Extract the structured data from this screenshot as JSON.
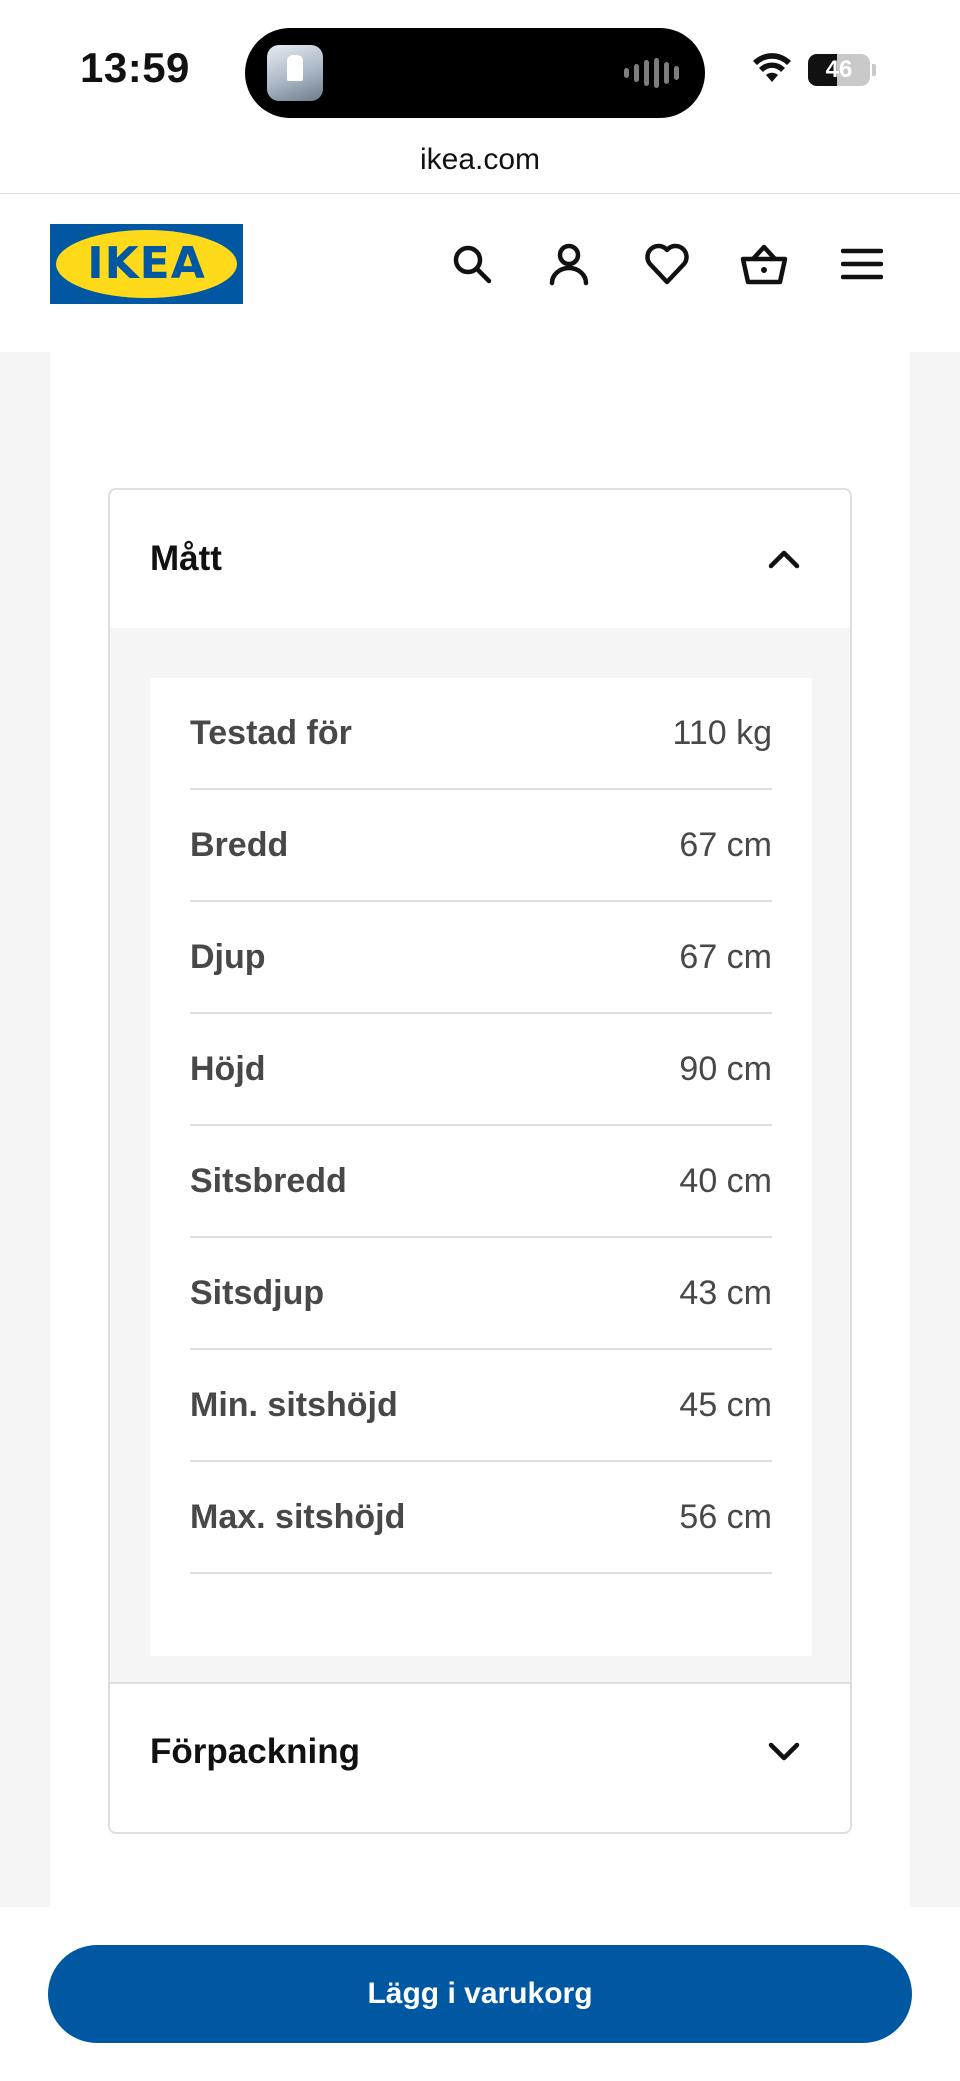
{
  "status_bar": {
    "time": "13:59",
    "battery_level": "46",
    "battery_fraction": 0.46
  },
  "browser": {
    "url": "ikea.com"
  },
  "header": {
    "logo_text": "IKEA",
    "icons": [
      "search-icon",
      "account-icon",
      "heart-icon",
      "basket-icon",
      "menu-icon"
    ]
  },
  "dimensions": {
    "title": "Mått",
    "expanded": true,
    "rows": [
      {
        "label": "Testad för",
        "value": "110 kg"
      },
      {
        "label": "Bredd",
        "value": "67 cm"
      },
      {
        "label": "Djup",
        "value": "67 cm"
      },
      {
        "label": "Höjd",
        "value": "90 cm"
      },
      {
        "label": "Sitsbredd",
        "value": "40 cm"
      },
      {
        "label": "Sitsdjup",
        "value": "43 cm"
      },
      {
        "label": "Min. sitshöjd",
        "value": "45 cm"
      },
      {
        "label": "Max. sitshöjd",
        "value": "56 cm"
      }
    ]
  },
  "packaging": {
    "title": "Förpackning",
    "expanded": false
  },
  "cta": {
    "label": "Lägg i varukorg"
  },
  "colors": {
    "ikea_blue": "#0058a3",
    "ikea_yellow": "#ffda1a",
    "panel_grey": "#f5f5f5",
    "divider": "#dfdfdf",
    "text_secondary": "#484848"
  }
}
